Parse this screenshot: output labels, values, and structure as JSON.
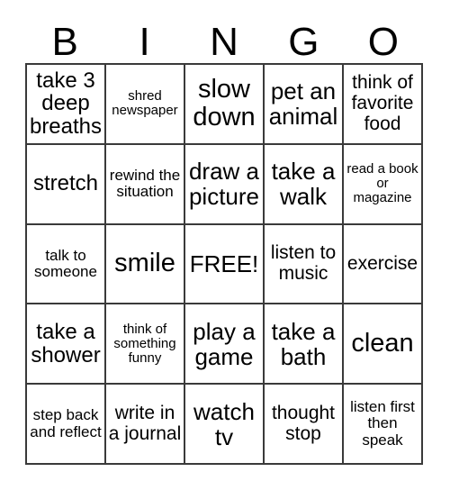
{
  "card": {
    "title_letters": [
      "B",
      "I",
      "N",
      "G",
      "O"
    ],
    "rows": [
      [
        {
          "text": "take 3 deep breaths",
          "size": "fs-md"
        },
        {
          "text": "shred newspaper",
          "size": "fs-xxs"
        },
        {
          "text": "slow down",
          "size": "fs-xl"
        },
        {
          "text": "pet an animal",
          "size": "fs-lg"
        },
        {
          "text": "think of favorite food",
          "size": "fs-sm"
        }
      ],
      [
        {
          "text": "stretch",
          "size": "fs-md"
        },
        {
          "text": "rewind the situation",
          "size": "fs-xs"
        },
        {
          "text": "draw a picture",
          "size": "fs-lg"
        },
        {
          "text": "take a walk",
          "size": "fs-lg"
        },
        {
          "text": "read a book or magazine",
          "size": "fs-xxs"
        }
      ],
      [
        {
          "text": "talk to someone",
          "size": "fs-xs"
        },
        {
          "text": "smile",
          "size": "fs-xl"
        },
        {
          "text": "FREE!",
          "size": "fs-lg"
        },
        {
          "text": "listen to music",
          "size": "fs-sm"
        },
        {
          "text": "exercise",
          "size": "fs-sm"
        }
      ],
      [
        {
          "text": "take a shower",
          "size": "fs-md"
        },
        {
          "text": "think of something funny",
          "size": "fs-xxs"
        },
        {
          "text": "play a game",
          "size": "fs-lg"
        },
        {
          "text": "take a bath",
          "size": "fs-lg"
        },
        {
          "text": "clean",
          "size": "fs-xl"
        }
      ],
      [
        {
          "text": "step back and reflect",
          "size": "fs-xs"
        },
        {
          "text": "write in a journal",
          "size": "fs-sm"
        },
        {
          "text": "watch tv",
          "size": "fs-lg"
        },
        {
          "text": "thought stop",
          "size": "fs-sm"
        },
        {
          "text": "listen first then speak",
          "size": "fs-xs"
        }
      ]
    ]
  },
  "colors": {
    "border": "#3a3a3a",
    "text": "#000000",
    "background": "#ffffff"
  }
}
